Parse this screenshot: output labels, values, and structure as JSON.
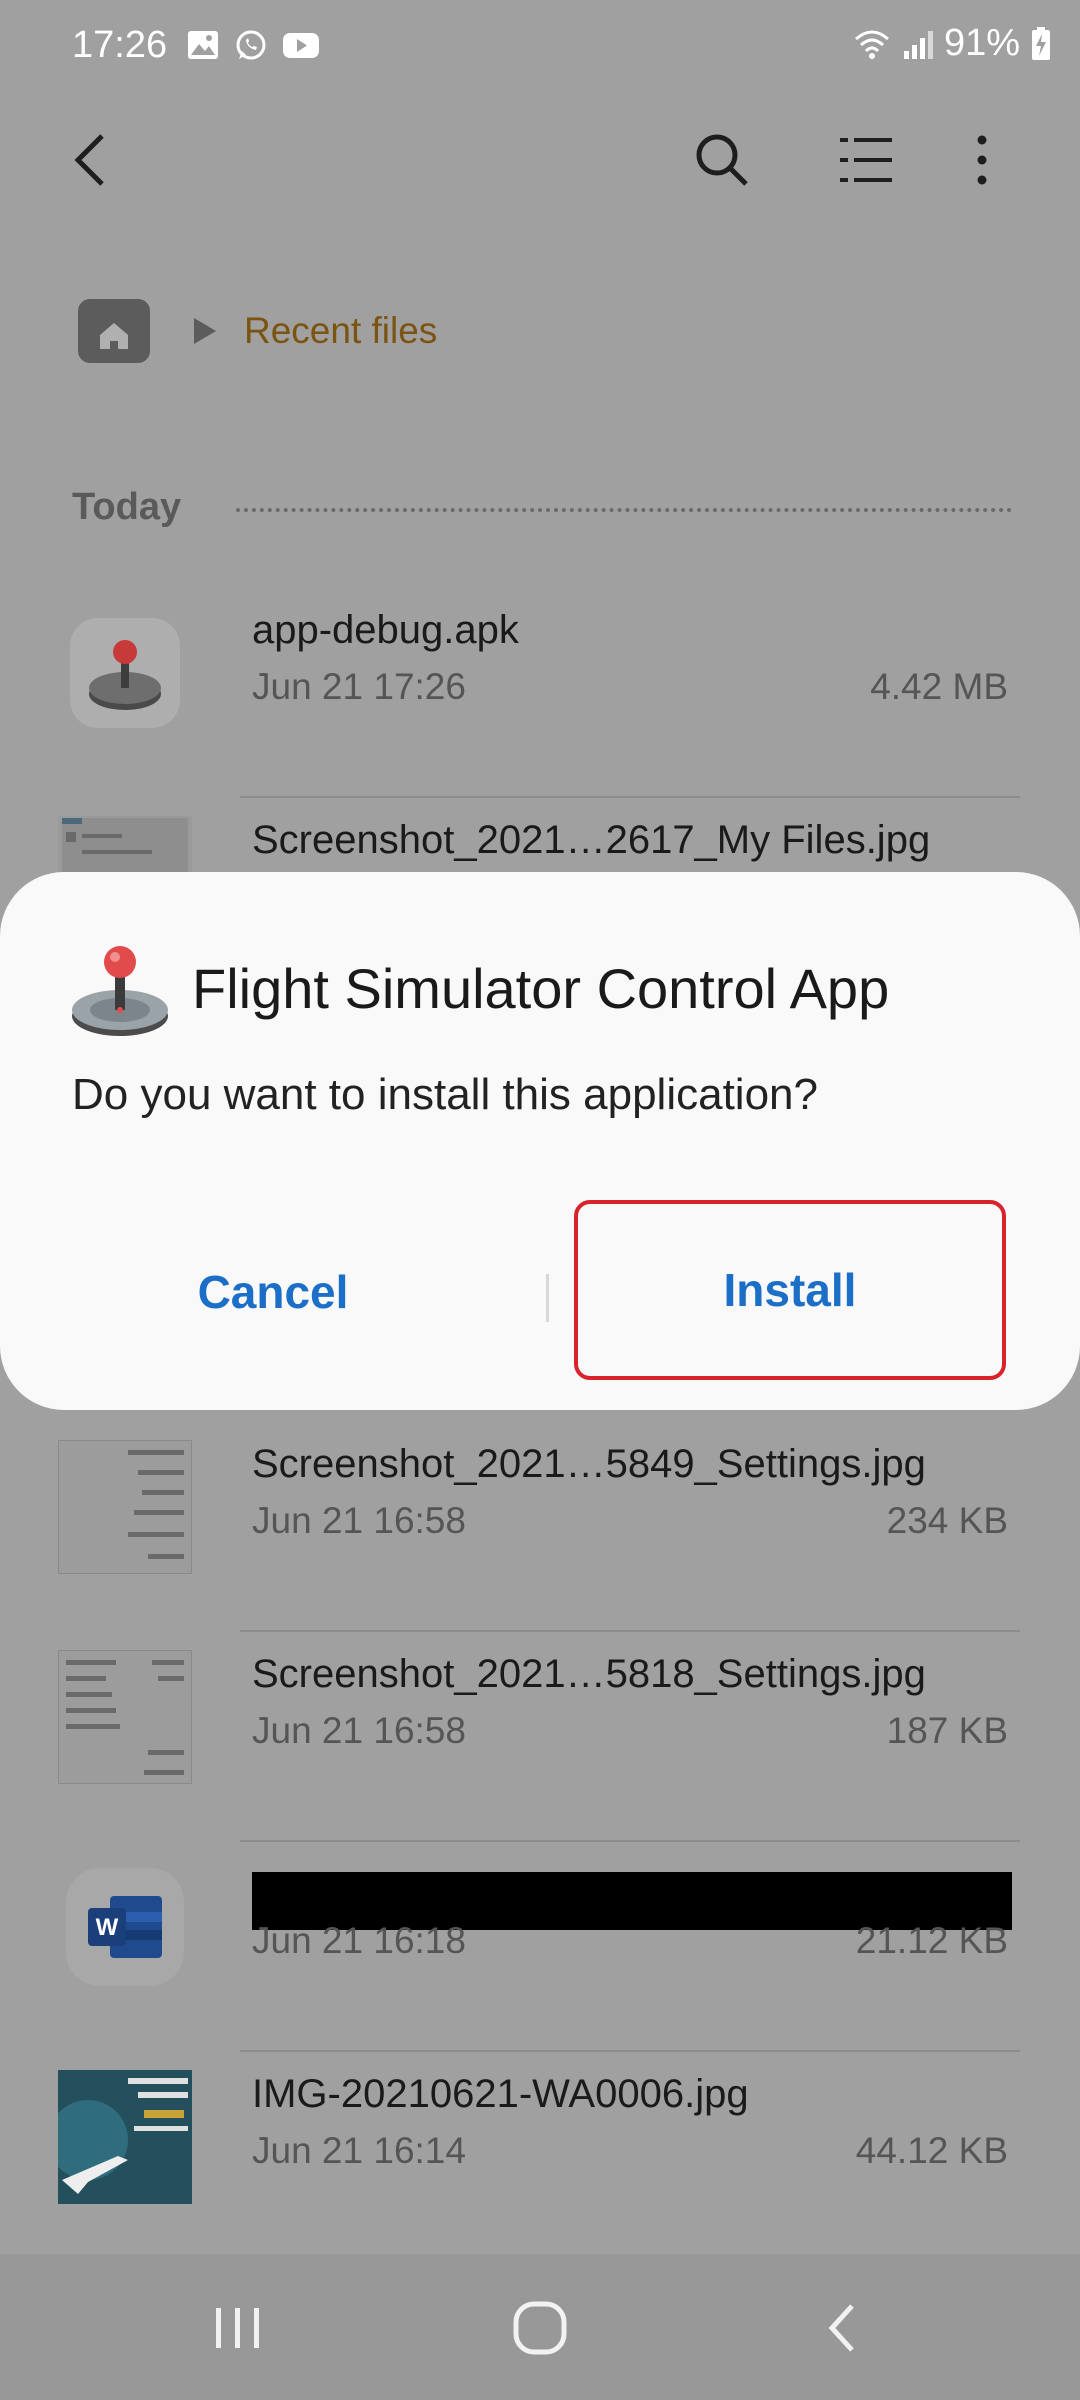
{
  "status_bar": {
    "time": "17:26",
    "battery": "91%",
    "icons_left": [
      "gallery-icon",
      "whatsapp-icon",
      "youtube-icon"
    ],
    "icons_right": [
      "wifi-icon",
      "signal-icon",
      "battery-charging-icon"
    ]
  },
  "toolbar": {
    "icons": [
      "back-icon",
      "search-icon",
      "list-view-icon",
      "more-options-icon"
    ]
  },
  "breadcrumb": {
    "current": "Recent files"
  },
  "section": {
    "label": "Today"
  },
  "files": [
    {
      "name": "app-debug.apk",
      "date": "Jun 21 17:26",
      "size": "4.42 MB",
      "thumb": "apk-joystick-icon"
    },
    {
      "name": "Screenshot_2021…2617_My Files.jpg",
      "date": "",
      "size": "",
      "thumb": "screenshot-thumbnail"
    },
    {
      "name": "Screenshot_2021…5849_Settings.jpg",
      "date": "Jun 21 16:58",
      "size": "234 KB",
      "thumb": "screenshot-thumbnail"
    },
    {
      "name": "Screenshot_2021…5818_Settings.jpg",
      "date": "Jun 21 16:58",
      "size": "187 KB",
      "thumb": "screenshot-thumbnail"
    },
    {
      "name": "",
      "date": "Jun 21 16:18",
      "size": "21.12 KB",
      "thumb": "word-icon"
    },
    {
      "name": "IMG-20210621-WA0006.jpg",
      "date": "Jun 21 16:14",
      "size": "44.12 KB",
      "thumb": "image-thumbnail"
    }
  ],
  "dialog": {
    "title": "Flight Simulator Control App",
    "message": "Do you want to install this application?",
    "cancel_label": "Cancel",
    "install_label": "Install",
    "highlight_color": "#d8232a",
    "button_color": "#1b6fc7"
  },
  "nav_bar": {
    "icons": [
      "recent-apps-icon",
      "home-icon",
      "back-icon"
    ]
  }
}
